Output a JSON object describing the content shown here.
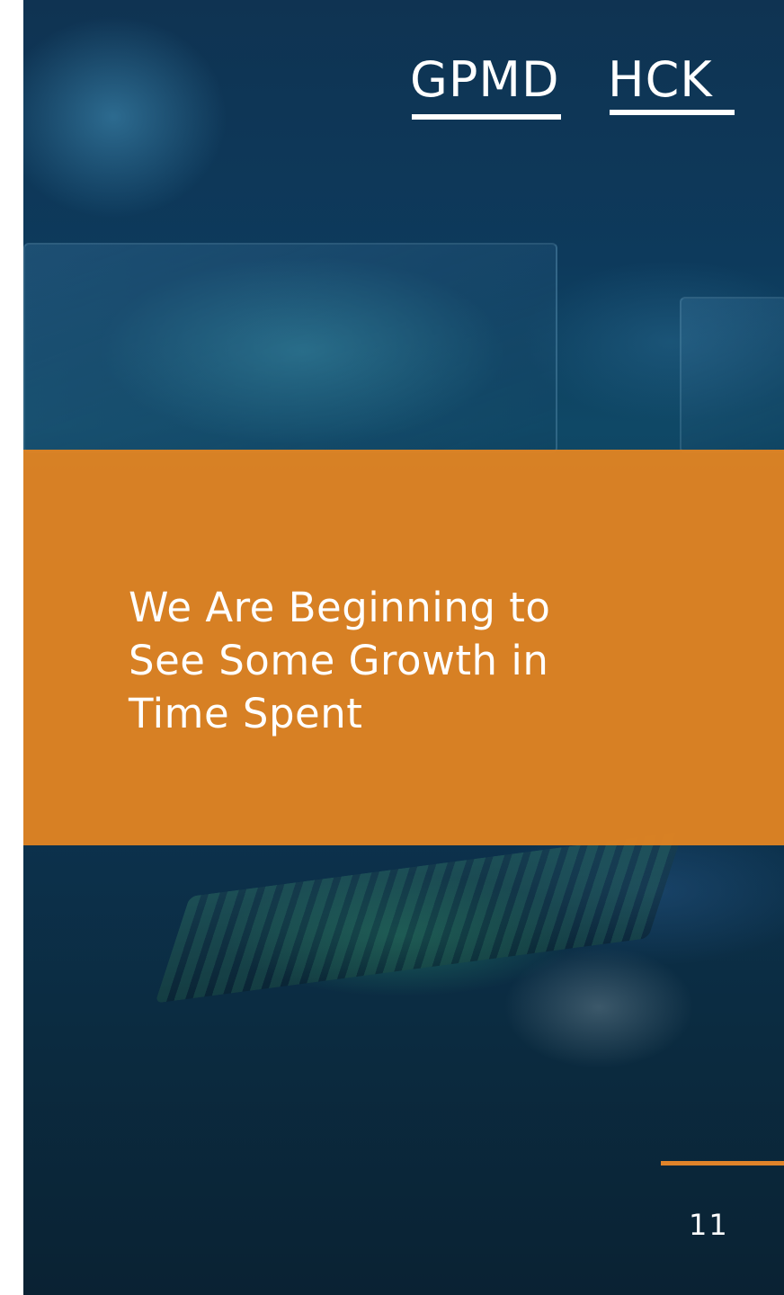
{
  "logo": {
    "part1": "GPMD",
    "part2": "HCK"
  },
  "banner": {
    "headline": "We Are Beginning to See Some Growth in Time Spent"
  },
  "footer": {
    "page_number": "11"
  },
  "colors": {
    "accent_orange": "#e0832a",
    "background_dark": "#0c3350",
    "text": "#ffffff"
  }
}
